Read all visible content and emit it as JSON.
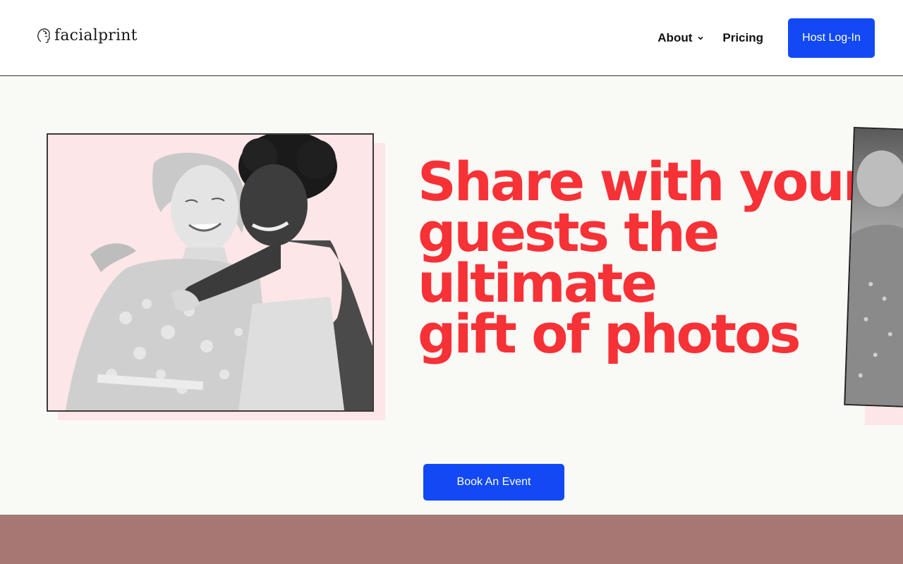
{
  "header": {
    "logo_text": "facialprint",
    "nav": {
      "about_label": "About",
      "pricing_label": "Pricing",
      "login_label": "Host Log-In"
    }
  },
  "hero": {
    "headline_lines": [
      "Share with your",
      "guests the",
      "ultimate",
      "gift of photos"
    ],
    "cta_label": "Book An Event"
  },
  "colors": {
    "accent_blue": "#1249f5",
    "headline_red": "#f63237",
    "pink_panel": "#fde6e7",
    "footer_band": "#a77774",
    "hero_background": "#f9f9f6"
  },
  "icons": {
    "logo": "face-mark-icon",
    "about_dropdown": "chevron-down-icon"
  }
}
